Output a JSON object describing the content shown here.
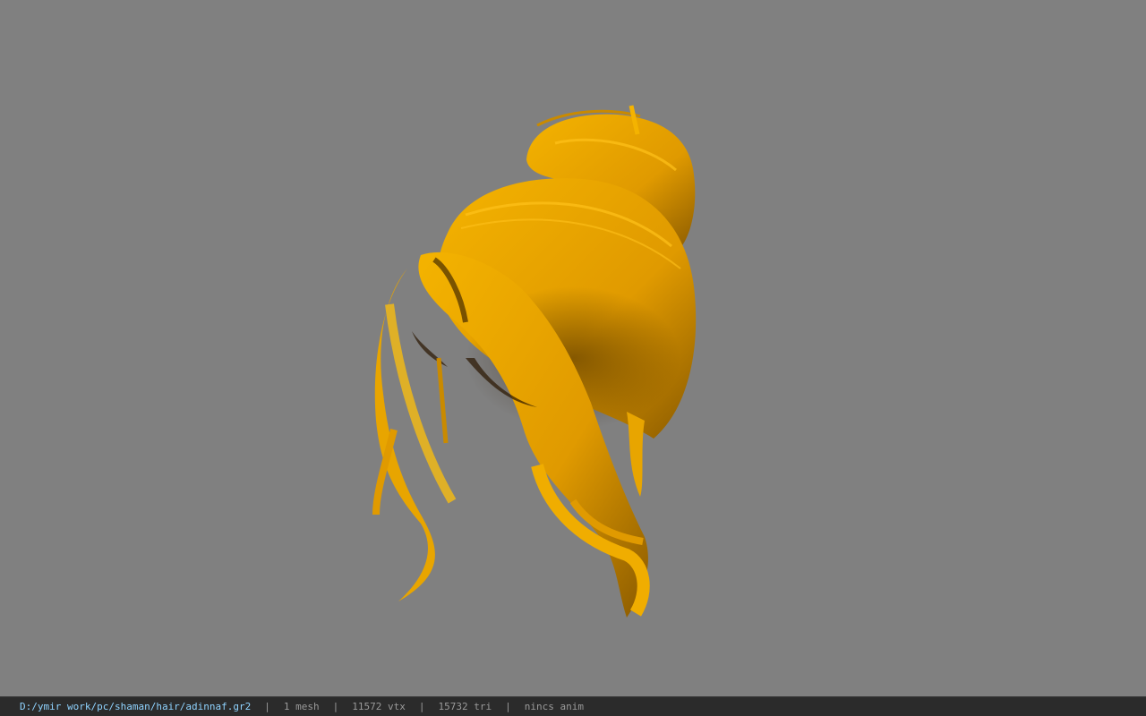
{
  "viewport": {
    "background": "#808080",
    "model_color": "#f0a800",
    "model_shadow_color": "#3a2000"
  },
  "status_bar": {
    "file_path": "D:/ymir work/pc/shaman/hair/adinnaf.gr2",
    "separator": "|",
    "mesh_count": "1 mesh",
    "vertex_count": "11572 vtx",
    "triangle_count": "15732 tri",
    "anim_status": "nincs anim",
    "path_color": "#8fd3ff",
    "text_color": "#9a9a9a",
    "background": "#2b2b2b"
  }
}
